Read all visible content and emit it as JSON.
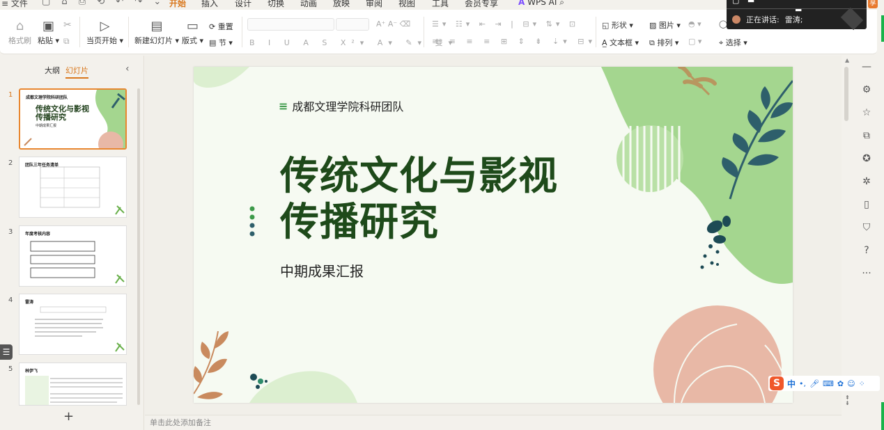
{
  "menubar": {
    "file": "≡ 文件",
    "tabs": [
      {
        "label": "开始",
        "active": true
      },
      {
        "label": "插入"
      },
      {
        "label": "设计"
      },
      {
        "label": "切换"
      },
      {
        "label": "动画"
      },
      {
        "label": "放映"
      },
      {
        "label": "审阅"
      },
      {
        "label": "视图"
      },
      {
        "label": "工具"
      },
      {
        "label": "会员专享"
      }
    ],
    "wps_ai": "WPS AI"
  },
  "ribbon": {
    "format_painter": "格式刷",
    "paste": "粘贴",
    "start_from_page": "当页开始",
    "new_slide": "新建幻灯片",
    "layout": "版式",
    "reset": "重置",
    "section": "节",
    "shape": "形状",
    "picture": "图片",
    "textbox": "文本框",
    "arrange": "排列",
    "select": "选择"
  },
  "meeting": {
    "speaking_label": "正在讲话:",
    "speaker": "雷涛;"
  },
  "left_panel": {
    "tab_outline": "大纲",
    "tab_slides": "幻灯片",
    "thumbnails": [
      {
        "num": "1",
        "title": "成都文理学院科研团队",
        "big": "传统文化与影视传播研究",
        "sub": "中期成果汇报",
        "selected": true
      },
      {
        "num": "2",
        "title": "团队三年任务清单"
      },
      {
        "num": "3",
        "title": "年度考核内容"
      },
      {
        "num": "4",
        "title": "雷涛"
      },
      {
        "num": "5",
        "title": "林伊飞"
      }
    ]
  },
  "slide": {
    "team": "成都文理学院科研团队",
    "title_line1": "传统文化与影视",
    "title_line2": "传播研究",
    "subtitle": "中期成果汇报"
  },
  "notes_placeholder": "单击此处添加备注",
  "ime": {
    "lang": "中"
  },
  "colors": {
    "accent": "#d9771c",
    "title_green": "#1e4a1a",
    "leaf_green": "#a4d68f",
    "teal": "#2e5f6b",
    "peach": "#e8b8a6"
  }
}
